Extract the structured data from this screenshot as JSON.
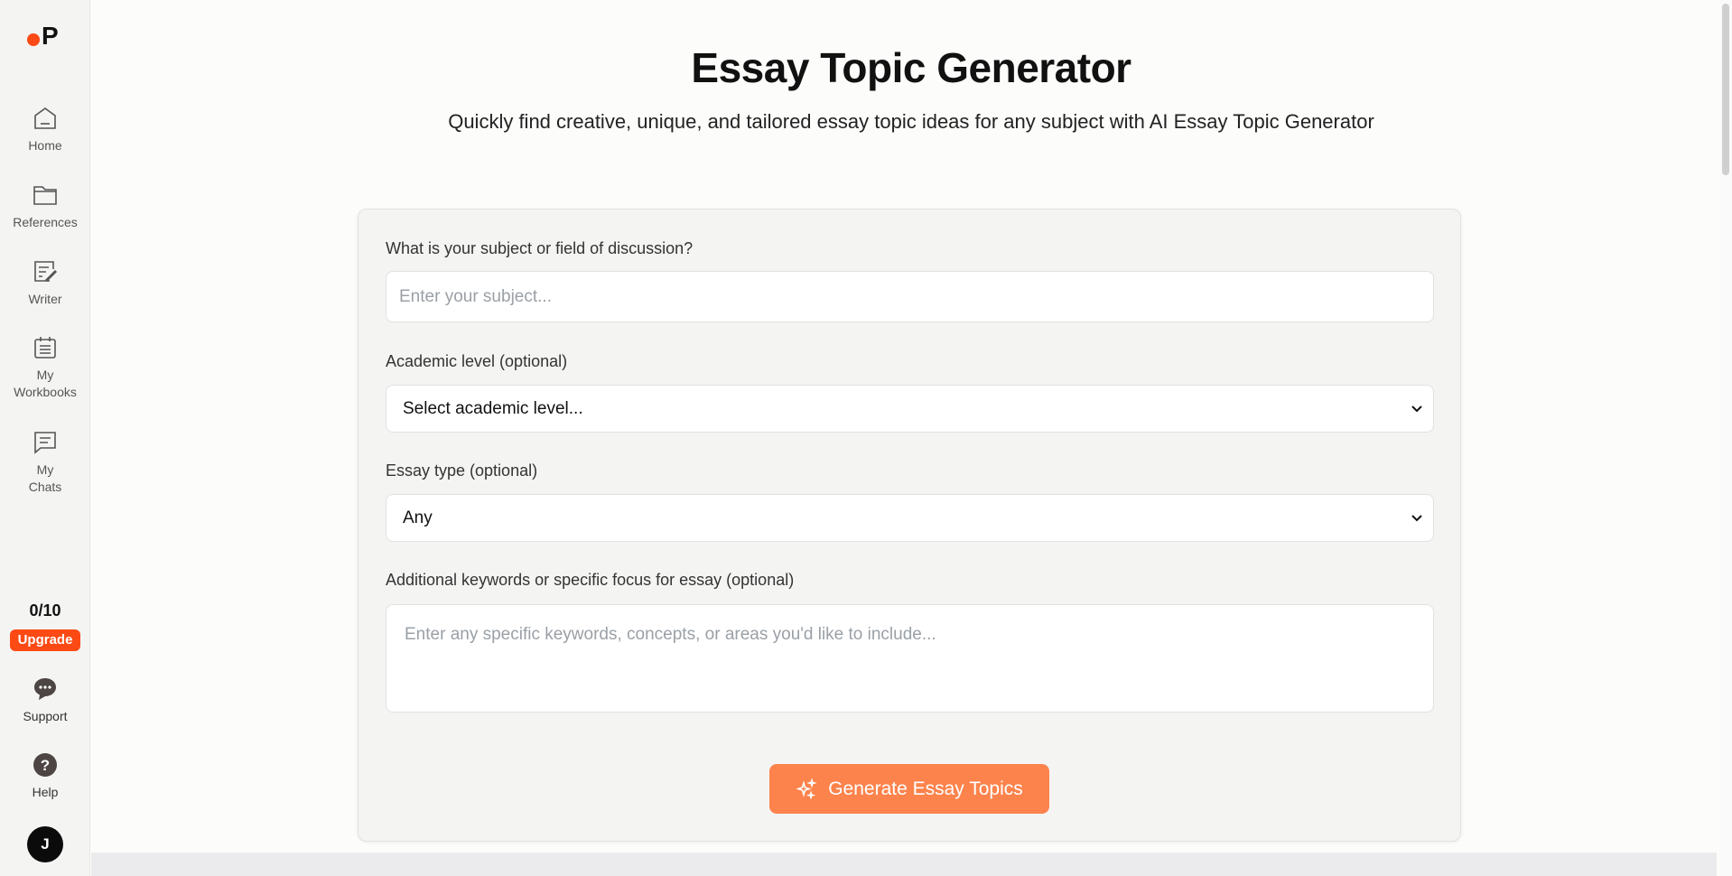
{
  "sidebar": {
    "logo": "P",
    "items": [
      {
        "label": "Home",
        "icon": "home-icon"
      },
      {
        "label": "References",
        "icon": "folder-icon"
      },
      {
        "label": "Writer",
        "icon": "writer-icon"
      },
      {
        "label": "My Workbooks",
        "icon": "calendar-icon"
      },
      {
        "label": "My Chats",
        "icon": "chat-icon"
      }
    ],
    "usage": "0/10",
    "upgrade": "Upgrade",
    "support": "Support",
    "help": "Help",
    "avatar": "J"
  },
  "page": {
    "title": "Essay Topic Generator",
    "subtitle": "Quickly find creative, unique, and tailored essay topic ideas for any subject with AI Essay Topic Generator"
  },
  "form": {
    "subject_label": "What is your subject or field of discussion?",
    "subject_placeholder": "Enter your subject...",
    "level_label": "Academic level (optional)",
    "level_value": "Select academic level...",
    "type_label": "Essay type (optional)",
    "type_value": "Any",
    "keywords_label": "Additional keywords or specific focus for essay (optional)",
    "keywords_placeholder": "Enter any specific keywords, concepts, or areas you'd like to include...",
    "submit": "Generate Essay Topics"
  },
  "colors": {
    "brand": "#fc4a14",
    "button": "#fc834c"
  }
}
